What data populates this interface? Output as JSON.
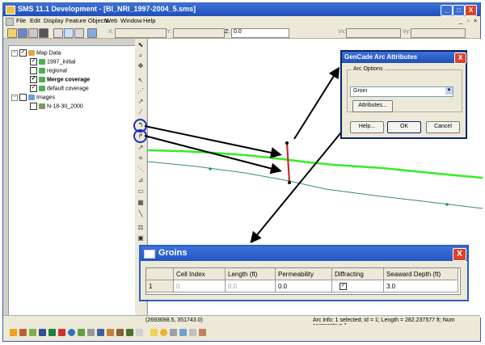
{
  "window": {
    "title": "SMS 11.1 Development - [BI_NRI_1997-2004_5.sms]",
    "controls": [
      "_",
      "□",
      "X"
    ]
  },
  "menu": [
    "File",
    "Edit",
    "Display",
    "Feature Objects",
    "Web",
    "Window",
    "Help"
  ],
  "toolbar": {
    "x_label": "X:",
    "y_label": "Y:",
    "z_label": "Z:",
    "z_value": "0.0",
    "vx_label": "Vx:",
    "vy_label": "Vy:"
  },
  "tree": {
    "root": "Map Data",
    "items": [
      "1997_initial",
      "regional",
      "Merge coverage",
      "default coverage"
    ],
    "images_label": "Images",
    "image_items": [
      "N-18-30_2000"
    ]
  },
  "gencade_dialog": {
    "title": "GenCade Arc Attributes",
    "group_label": "Arc Options",
    "selected_option": "Groin",
    "attributes_button": "Attributes...",
    "help_button": "Help...",
    "ok_button": "OK",
    "cancel_button": "Cancel",
    "close": "X"
  },
  "groins_dialog": {
    "title": "Groins",
    "close": "X",
    "columns": [
      "Cell Index",
      "Length (ft)",
      "Permeability",
      "Diffracting",
      "Seaward Depth (ft)"
    ],
    "rows": [
      {
        "row": "1",
        "cell_index": "0",
        "length": "0.0",
        "permeability": "0.0",
        "diffracting": true,
        "seaward_depth": "3.0"
      }
    ]
  },
  "status": {
    "coordinates": "(2693698.5, 351743.0)",
    "arc_info": "Arc info: 1 selected; id = 1; Length = 282.237577 ft; Num segments = 1."
  },
  "colors": {
    "shoreline": "#33ee22",
    "baseline": "#2f8c7c",
    "arrow": "#000000",
    "highlight_circle": "#1d2fbf",
    "groin_arc": "#c0302a"
  }
}
